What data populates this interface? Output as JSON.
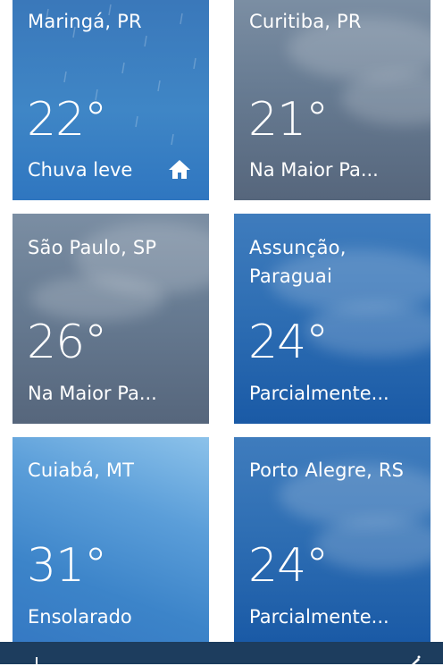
{
  "tiles": [
    {
      "city": "Maringá, PR",
      "temp": "22°",
      "condition": "Chuva leve",
      "home": true
    },
    {
      "city": "Curitiba, PR",
      "temp": "21°",
      "condition": "Na Maior Pa..."
    },
    {
      "city": "São Paulo, SP",
      "temp": "26°",
      "condition": "Na Maior Pa..."
    },
    {
      "city": "Assunção, Paraguai",
      "temp": "24°",
      "condition": "Parcialmente..."
    },
    {
      "city": "Cuiabá, MT",
      "temp": "31°",
      "condition": "Ensolarado"
    },
    {
      "city": "Porto Alegre, RS",
      "temp": "24°",
      "condition": "Parcialmente..."
    }
  ],
  "icons": {
    "home": "home-icon"
  }
}
